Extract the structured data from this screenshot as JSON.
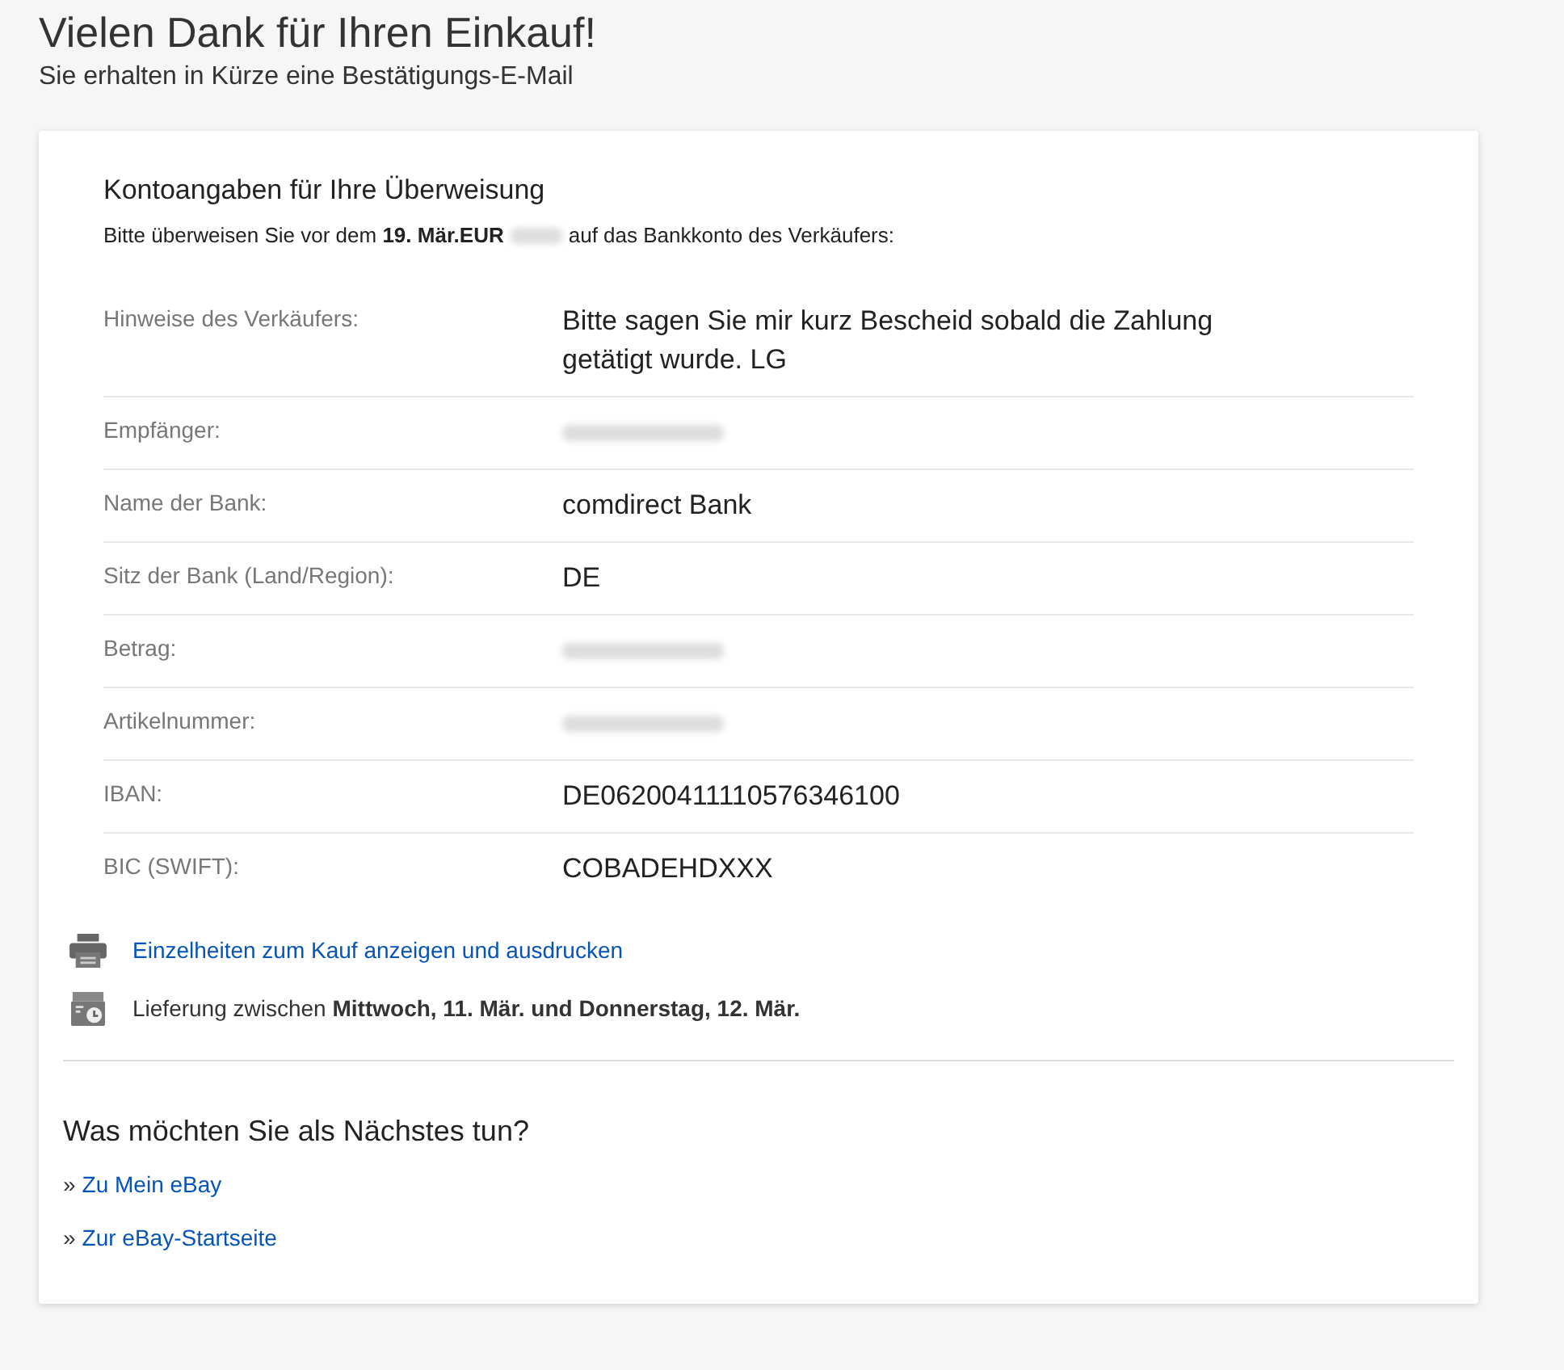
{
  "header": {
    "title": "Vielen Dank für Ihren Einkauf!",
    "subtitle": "Sie erhalten in Kürze eine Bestätigungs-E-Mail"
  },
  "payment": {
    "heading": "Kontoangaben für Ihre Überweisung",
    "instruction_before": "Bitte überweisen Sie vor dem **19. Mär.EUR**",
    "instruction_after": "auf das Bankkonto des Verkäufers:",
    "rows": [
      {
        "label": "Hinweise des Verkäufers:",
        "kind": "text",
        "value": "Bitte sagen Sie mir kurz Bescheid sobald die Zahlung getätigt wurde. LG"
      },
      {
        "label": "Empfänger:",
        "kind": "redacted"
      },
      {
        "label": "Name der Bank:",
        "kind": "text",
        "value": "comdirect Bank"
      },
      {
        "label": "Sitz der Bank (Land/Region):",
        "kind": "text",
        "value": "DE"
      },
      {
        "label": "Betrag:",
        "kind": "redacted"
      },
      {
        "label": "Artikelnummer:",
        "kind": "redacted"
      },
      {
        "label": "IBAN:",
        "kind": "text",
        "value": "DE06200411110576346100"
      },
      {
        "label": "BIC (SWIFT):",
        "kind": "text",
        "value": "COBADEHDXXX"
      }
    ]
  },
  "actions": [
    {
      "kind": "print",
      "text": "Einzelheiten zum Kauf anzeigen und ausdrucken"
    },
    {
      "kind": "delivery",
      "text": "Lieferung zwischen **Mittwoch, 11. Mär. und Donnerstag, 12. Mär.**"
    }
  ],
  "next": {
    "heading": "Was möchten Sie als Nächstes tun?",
    "links": [
      {
        "bullet": "»",
        "text": "Zu Mein eBay"
      },
      {
        "bullet": "»",
        "text": "Zur eBay-Startseite"
      }
    ]
  }
}
